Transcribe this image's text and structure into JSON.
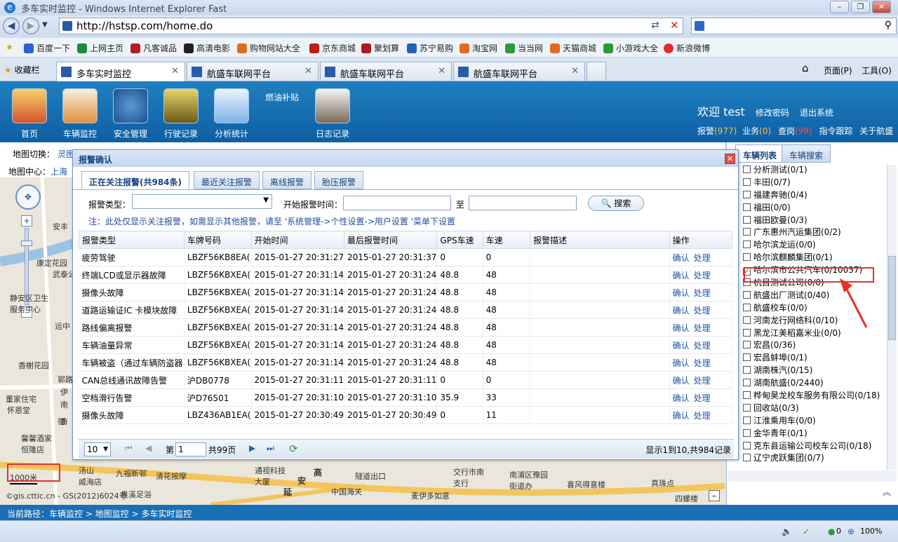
{
  "window": {
    "title": "多车实时监控 - Windows Internet Explorer Fast"
  },
  "browser": {
    "url": "http://hstsp.com/home.do"
  },
  "favorites": [
    "百度一下",
    "上网主页",
    "凡客诚品",
    "高清电影",
    "购物网站大全",
    "京东商城",
    "聚划算",
    "苏宁易购",
    "淘宝网",
    "当当网",
    "天猫商城",
    "小游戏大全",
    "新浪微博"
  ],
  "favbar_label": "收藏栏",
  "tabs": [
    "多车实时监控",
    "航盛车联网平台",
    "航盛车联网平台",
    "航盛车联网平台"
  ],
  "toolbar": {
    "page": "页面(P)",
    "tools": "工具(O)"
  },
  "app": {
    "modules": [
      "首页",
      "车辆监控",
      "安全管理",
      "行驶记录",
      "分析统计",
      "燃油补贴",
      "日志记录"
    ],
    "welcome": "欢迎 test",
    "change_pw": "修改密码",
    "logout": "退出系统",
    "stats": {
      "alarm_label": "报警",
      "alarm_count": "(977)",
      "biz_label": "业务",
      "biz_count": "(0)",
      "check_label": "查岗",
      "check_count": "(99)",
      "trace": "指令跟踪",
      "about": "关于航盛"
    }
  },
  "map": {
    "switch_label": "地图切换：",
    "switch_value": "灵图",
    "center_label": "地图中心：",
    "center_value": "上海",
    "places": [
      "安丰",
      "康定花园",
      "武泰公",
      "静安区卫生服务中心",
      "远中",
      "香榭花园",
      "郭路",
      "伊",
      "南",
      "奋",
      "德",
      "董家住宅",
      "怀恩堂",
      "馨馨酒家",
      "恒隆店",
      "汤山",
      "九福新邨",
      "威海店",
      "清花按摩",
      "通视科技大厦",
      "延",
      "安",
      "高",
      "隧道出口",
      "交行市南支行",
      "中国海关",
      "南浦区豫园街道办",
      "喜风得意楼",
      "真珠点",
      "良溪足浴",
      "麦伊多如意",
      "四螺楼"
    ],
    "scale": "1000米",
    "copyright": "©gis.cttic.cn - GS(2012)6024号"
  },
  "right_panel": {
    "tab_list": "车辆列表",
    "tab_search": "车辆搜索",
    "vehicles": [
      {
        "name": "分析测试(0/1)",
        "checked": false
      },
      {
        "name": "丰田(0/7)",
        "checked": false
      },
      {
        "name": "福建奔驰(0/4)",
        "checked": false
      },
      {
        "name": "福田(0/0)",
        "checked": false
      },
      {
        "name": "福田欧曼(0/3)",
        "checked": false
      },
      {
        "name": "广东惠州汽运集团(0/2)",
        "checked": false
      },
      {
        "name": "哈尔滨龙运(0/0)",
        "checked": false
      },
      {
        "name": "哈尔滨麒麟集团(0/1)",
        "checked": false
      },
      {
        "name": "哈尔滨市公共汽车(0/10037)",
        "checked": true
      },
      {
        "name": "杭目测试公司(0/0)",
        "checked": false
      },
      {
        "name": "航盛出厂测试(0/40)",
        "checked": false
      },
      {
        "name": "航盛校车(0/0)",
        "checked": false
      },
      {
        "name": "河南龙行网络科(0/10)",
        "checked": false
      },
      {
        "name": "黑龙江美稻嘉米业(0/0)",
        "checked": false
      },
      {
        "name": "宏昌(0/36)",
        "checked": false
      },
      {
        "name": "宏昌蚌埠(0/1)",
        "checked": false
      },
      {
        "name": "湖南株汽(0/15)",
        "checked": false
      },
      {
        "name": "湖南航盛(0/2440)",
        "checked": false
      },
      {
        "name": "桦甸昊龙校车服务有限公司(0/18)",
        "checked": false
      },
      {
        "name": "回收站(0/3)",
        "checked": false
      },
      {
        "name": "江淮乘用车(0/0)",
        "checked": false
      },
      {
        "name": "金华青年(0/1)",
        "checked": false
      },
      {
        "name": "克东县运输公司校车公司(0/18)",
        "checked": false
      },
      {
        "name": "辽宁虎跃集团(0/7)",
        "checked": false
      }
    ]
  },
  "dialog": {
    "title": "报警确认",
    "tabs": [
      "正在关注报警(共984条)",
      "最近关注报警",
      "离线报警",
      "胎压报警"
    ],
    "type_label": "报警类型：",
    "start_label": "开始报警时间：",
    "to_label": "至",
    "search_button": "搜索",
    "note": "注：此处仅显示关注报警，如需显示其他报警，请至 '系统管理->个性设置->用户设置 '菜单下设置",
    "columns": [
      "报警类型",
      "车牌号码",
      "开始时间",
      "最后报警时间",
      "GPS车速",
      "车速",
      "报警描述",
      "操作"
    ],
    "rows": [
      [
        "疲劳驾驶",
        "LBZF56KB8EA(",
        "2015-01-27 20:31:27",
        "2015-01-27 20:31:37",
        "0",
        "0",
        ""
      ],
      [
        "终端LCD或显示器故障",
        "LBZF56KBXEA(",
        "2015-01-27 20:31:14",
        "2015-01-27 20:31:24",
        "48.8",
        "48",
        ""
      ],
      [
        "摄像头故障",
        "LBZF56KBXEA(",
        "2015-01-27 20:31:14",
        "2015-01-27 20:31:24",
        "48.8",
        "48",
        ""
      ],
      [
        "道路运输证IC 卡模块故障",
        "LBZF56KBXEA(",
        "2015-01-27 20:31:14",
        "2015-01-27 20:31:24",
        "48.8",
        "48",
        ""
      ],
      [
        "路线偏离报警",
        "LBZF56KBXEA(",
        "2015-01-27 20:31:14",
        "2015-01-27 20:31:24",
        "48.8",
        "48",
        ""
      ],
      [
        "车辆油量异常",
        "LBZF56KBXEA(",
        "2015-01-27 20:31:14",
        "2015-01-27 20:31:24",
        "48.8",
        "48",
        ""
      ],
      [
        "车辆被盗（通过车辆防盗器",
        "LBZF56KBXEA(",
        "2015-01-27 20:31:14",
        "2015-01-27 20:31:24",
        "48.8",
        "48",
        ""
      ],
      [
        "CAN总线通讯故障告警",
        "沪DB0778",
        "2015-01-27 20:31:11",
        "2015-01-27 20:31:11",
        "0",
        "0",
        ""
      ],
      [
        "空档滑行告警",
        "沪D76501",
        "2015-01-27 20:31:10",
        "2015-01-27 20:31:10",
        "35.9",
        "33",
        ""
      ],
      [
        "摄像头故障",
        "LBZ436AB1EA(",
        "2015-01-27 20:30:49",
        "2015-01-27 20:30:49",
        "0",
        "11",
        ""
      ]
    ],
    "op_confirm": "确认",
    "op_handle": "处理",
    "pager": {
      "page_size": "10",
      "page_label": "第",
      "page_value": "1",
      "total_pages": "共99页",
      "summary": "显示1到10,共984记录"
    }
  },
  "breadcrumb": "当前路径：车辆监控 > 地图监控 > 多车实时监控",
  "iestatus": {
    "zoom": "100%",
    "count": "0"
  }
}
